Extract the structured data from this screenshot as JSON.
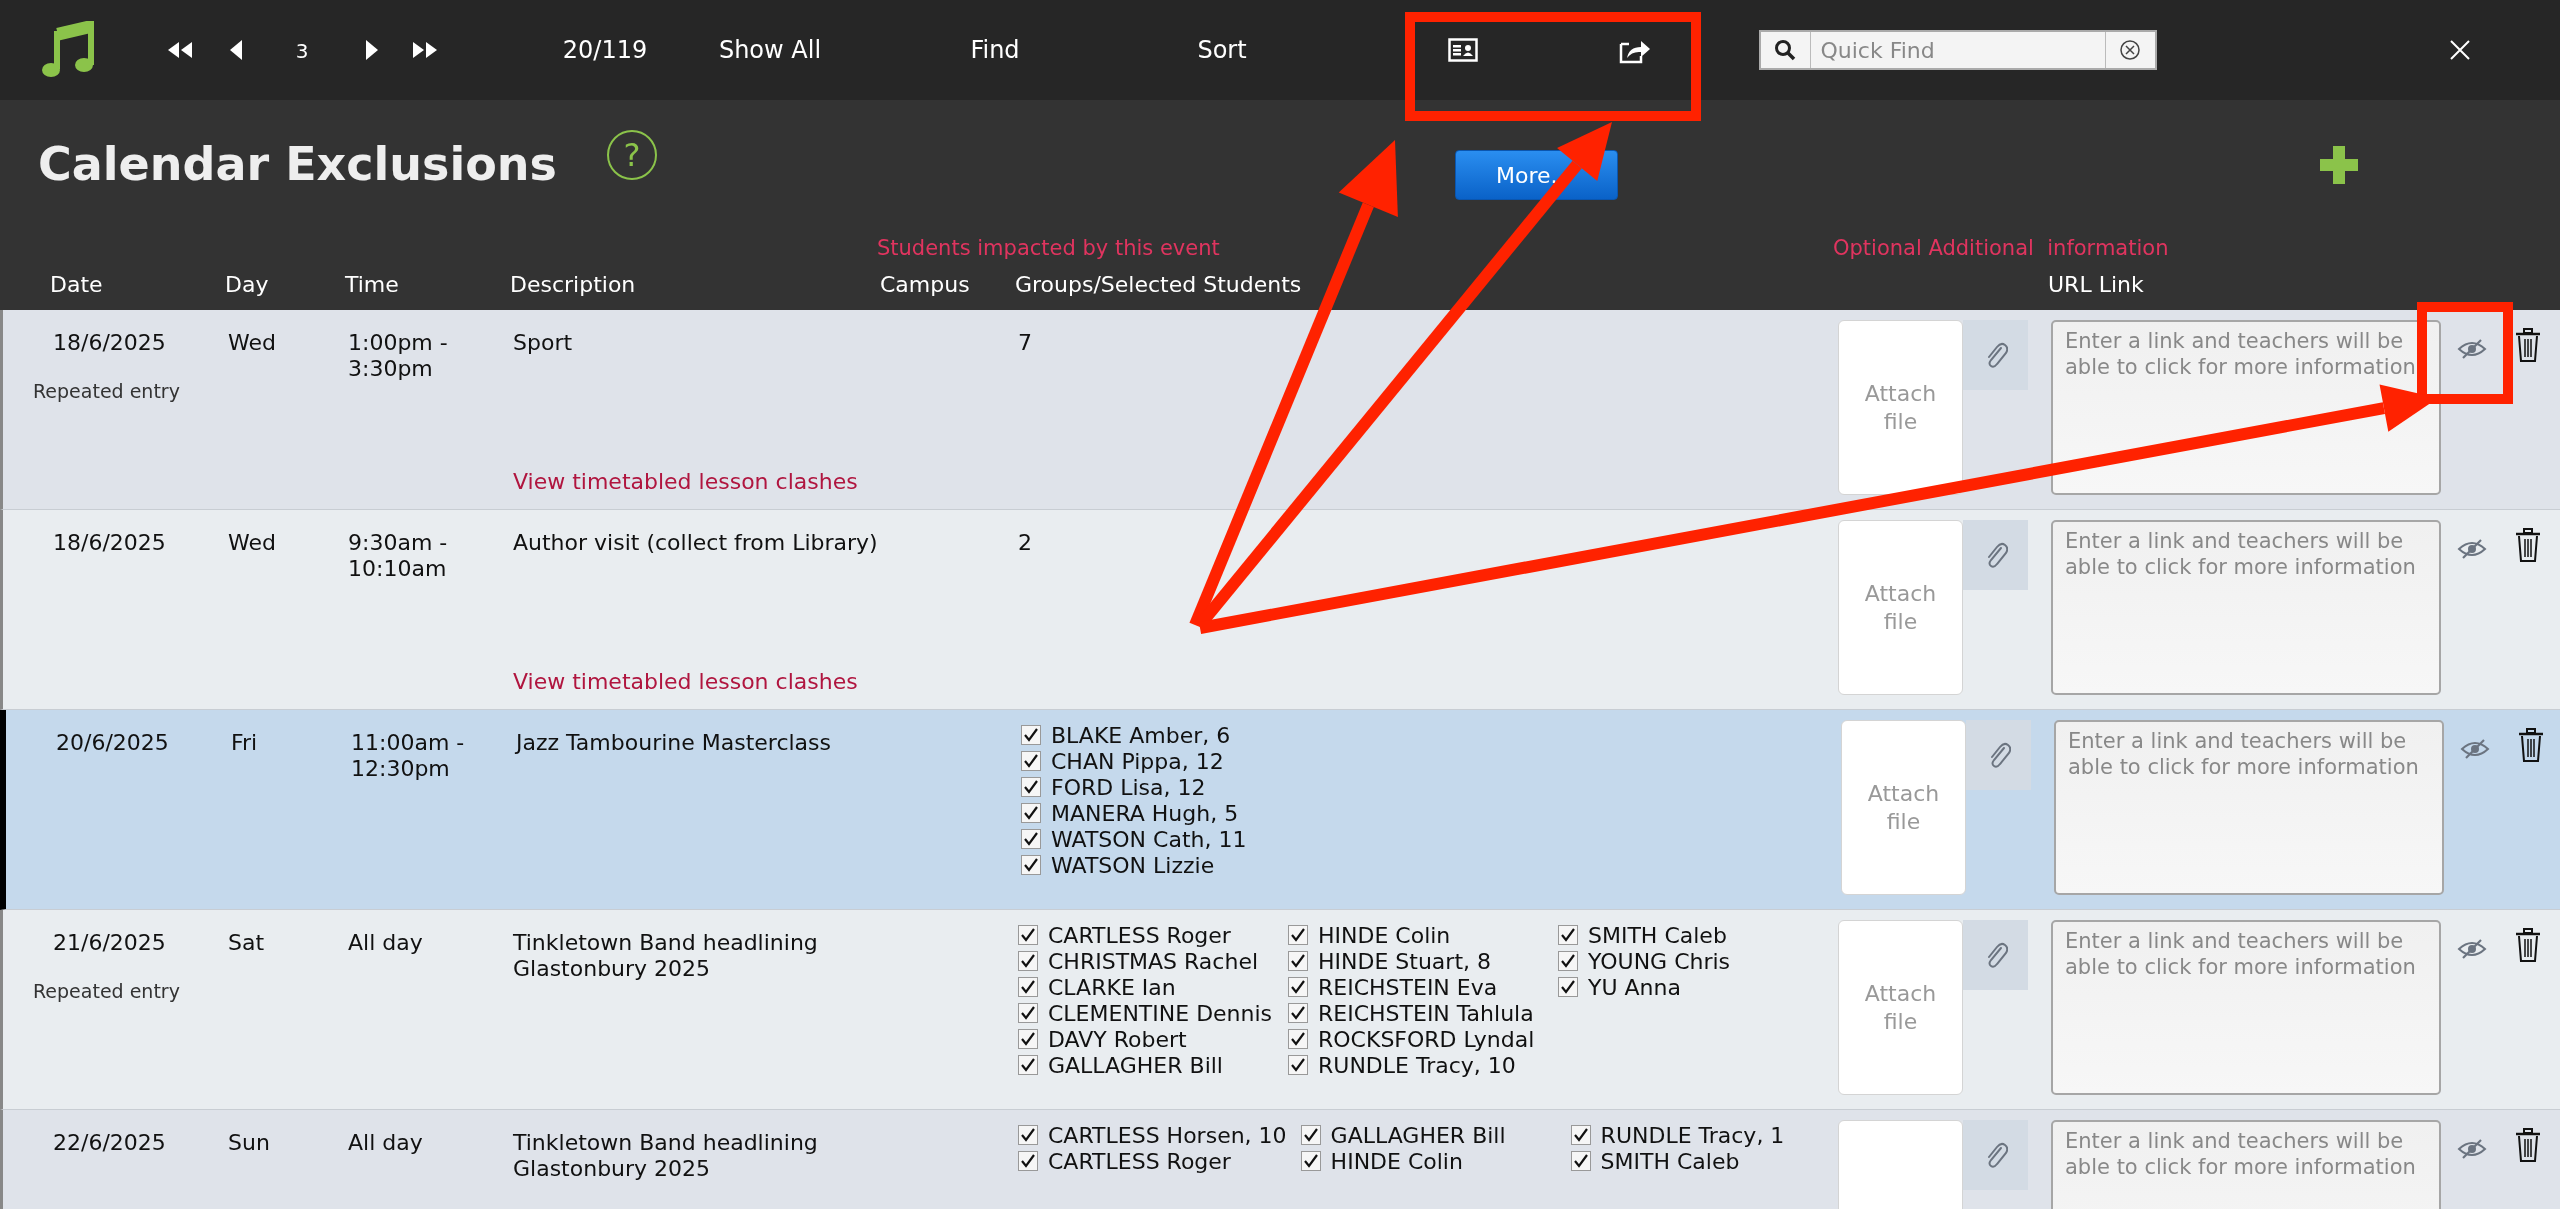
{
  "toolbar": {
    "record_number": "3",
    "record_count": "20/119",
    "buttons": [
      "Show All",
      "Find",
      "Sort"
    ],
    "search": {
      "placeholder": "Quick Find"
    }
  },
  "header": {
    "title": "Calendar Exclusions",
    "help": "?",
    "more_button": "More.",
    "section_labels": [
      "Students impacted by this event",
      "Optional Additional  information"
    ]
  },
  "table": {
    "columns": [
      "Date",
      "Day",
      "Time",
      "Description",
      "Campus",
      "Groups/Selected Students",
      "URL Link"
    ],
    "rows": [
      {
        "date": "18/6/2025",
        "day": "Wed",
        "time": "1:00pm - 3:30pm",
        "description": "Sport",
        "note": "Repeated entry",
        "clash_link": "View timetabled lesson clashes",
        "group_count": "7",
        "attach": "Attach file",
        "url_placeholder": "Enter a link and teachers will be able to click for more information",
        "selected": false
      },
      {
        "date": "18/6/2025",
        "day": "Wed",
        "time": "9:30am - 10:10am",
        "description": "Author visit (collect from Library)",
        "clash_link": "View timetabled lesson clashes",
        "group_count": "2",
        "attach": "Attach file",
        "url_placeholder": "Enter a link and teachers will be able to click for more information",
        "selected": false
      },
      {
        "date": "20/6/2025",
        "day": "Fri",
        "time": "11:00am - 12:30pm",
        "description": "Jazz Tambourine Masterclass",
        "students": [
          [
            {
              "name": "BLAKE Amber, 6",
              "checked": true
            },
            {
              "name": "CHAN Pippa, 12",
              "checked": true
            },
            {
              "name": "FORD Lisa, 12",
              "checked": true
            },
            {
              "name": "MANERA Hugh, 5",
              "checked": true
            },
            {
              "name": "WATSON Cath, 11",
              "checked": true
            },
            {
              "name": "WATSON Lizzie",
              "checked": true
            }
          ]
        ],
        "attach": "Attach file",
        "url_placeholder": "Enter a link and teachers will be able to click for more information",
        "selected": true
      },
      {
        "date": "21/6/2025",
        "day": "Sat",
        "time": "All day",
        "description": "Tinkletown Band headlining Glastonbury 2025",
        "note": "Repeated entry",
        "students": [
          [
            {
              "name": "CARTLESS Roger",
              "checked": true
            },
            {
              "name": "CHRISTMAS Rachel",
              "checked": true
            },
            {
              "name": "CLARKE Ian",
              "checked": true
            },
            {
              "name": "CLEMENTINE Dennis",
              "checked": true
            },
            {
              "name": "DAVY Robert",
              "checked": true
            },
            {
              "name": "GALLAGHER Bill",
              "checked": true
            }
          ],
          [
            {
              "name": "HINDE Colin",
              "checked": true
            },
            {
              "name": "HINDE Stuart, 8",
              "checked": true
            },
            {
              "name": "REICHSTEIN Eva",
              "checked": true
            },
            {
              "name": "REICHSTEIN Tahlula",
              "checked": true
            },
            {
              "name": "ROCKSFORD Lyndal",
              "checked": true
            },
            {
              "name": "RUNDLE Tracy, 10",
              "checked": true
            }
          ],
          [
            {
              "name": "SMITH Caleb",
              "checked": true
            },
            {
              "name": "YOUNG Chris",
              "checked": true
            },
            {
              "name": "YU Anna",
              "checked": true
            }
          ]
        ],
        "attach": "Attach file",
        "url_placeholder": "Enter a link and teachers will be able to click for more information",
        "selected": false
      },
      {
        "date": "22/6/2025",
        "day": "Sun",
        "time": "All day",
        "description": "Tinkletown Band headlining Glastonbury 2025",
        "students": [
          [
            {
              "name": "CARTLESS Horsen, 10",
              "checked": true
            },
            {
              "name": "CARTLESS Roger",
              "checked": true
            }
          ],
          [
            {
              "name": "GALLAGHER Bill",
              "checked": true
            },
            {
              "name": "HINDE Colin",
              "checked": true
            }
          ],
          [
            {
              "name": "RUNDLE Tracy, 1",
              "checked": true
            },
            {
              "name": "SMITH Caleb",
              "checked": true
            }
          ]
        ],
        "url_placeholder": "Enter a link and teachers will be able to click for more information",
        "selected": false
      }
    ]
  }
}
